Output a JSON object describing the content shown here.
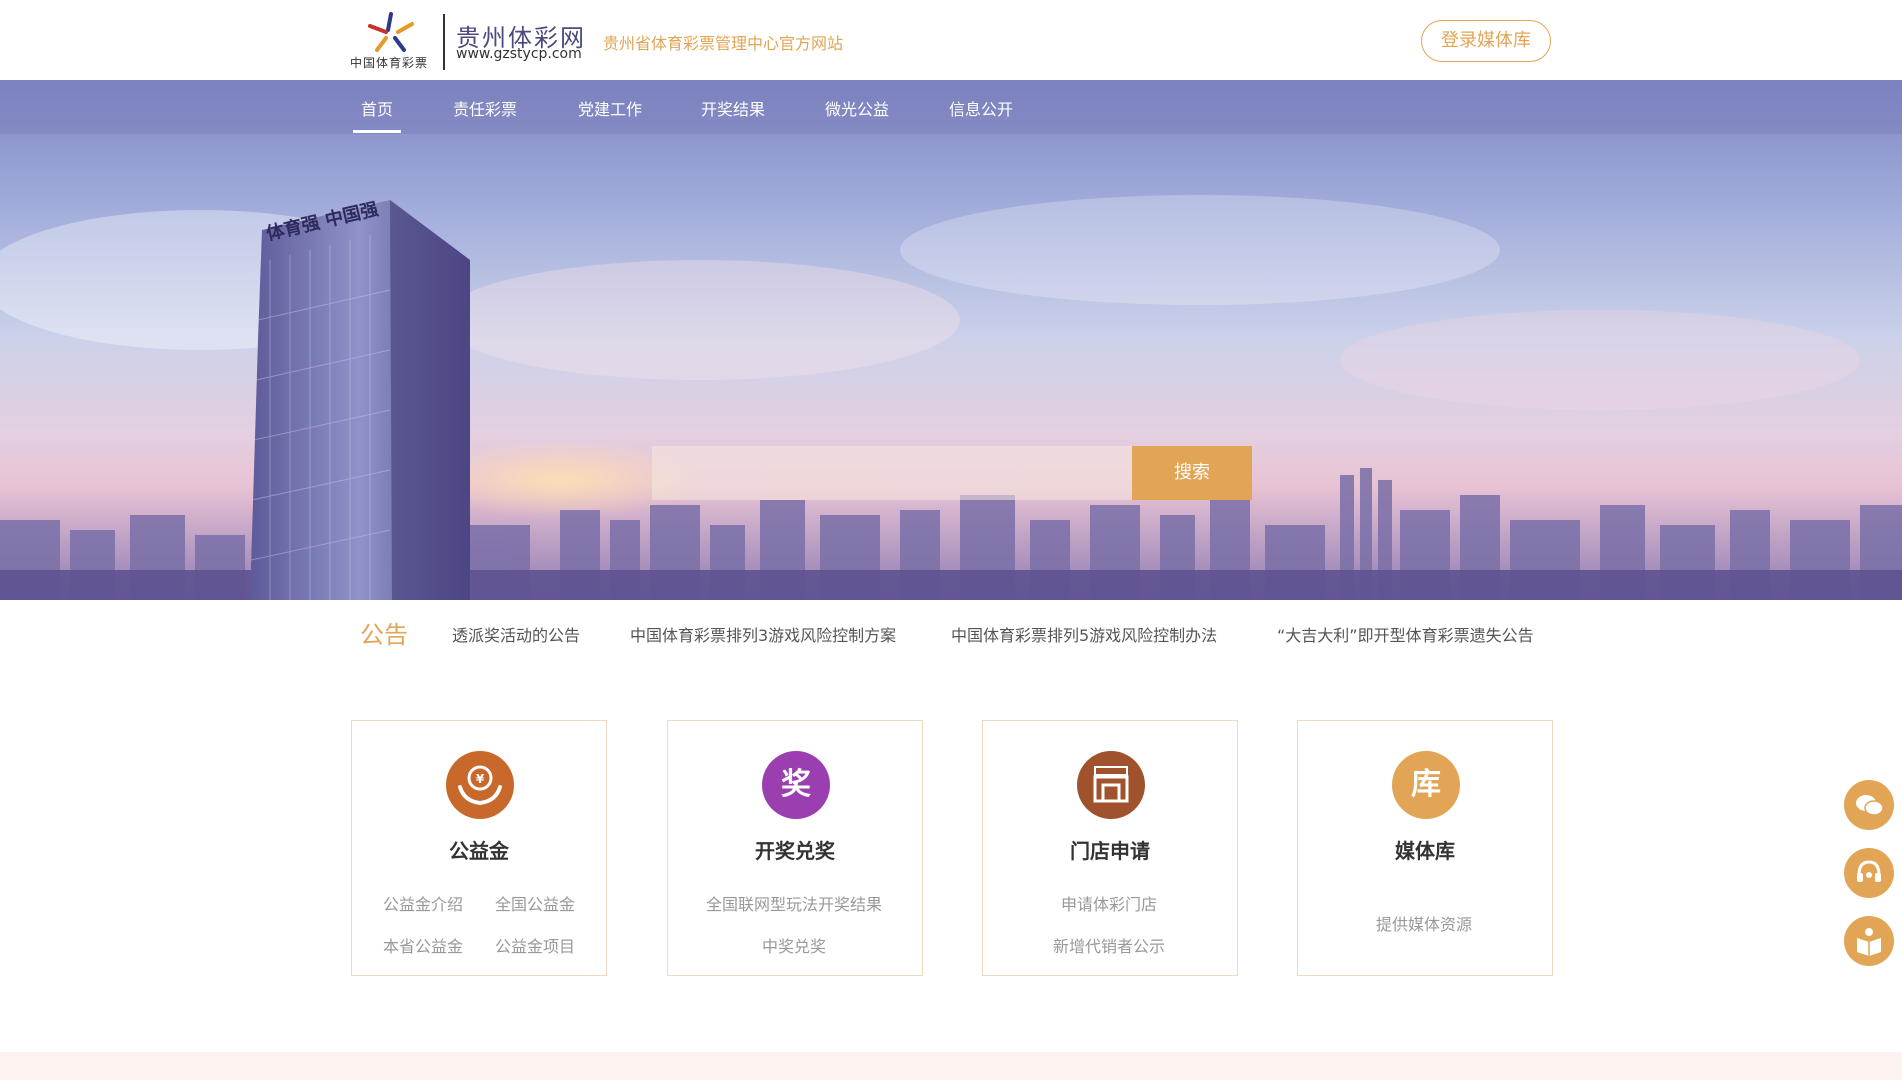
{
  "header": {
    "logo_caption": "中国体育彩票",
    "site_name": "贵州体彩网",
    "site_url": "www.gzstycp.com",
    "slogan": "贵州省体育彩票管理中心官方网站",
    "login_label": "登录媒体库"
  },
  "nav": {
    "items": [
      "首页",
      "责任彩票",
      "党建工作",
      "开奖结果",
      "微光公益",
      "信息公开"
    ],
    "active_index": 0
  },
  "hero": {
    "building_sign": "体育强 中国强",
    "search_value": "",
    "search_button_label": "搜索"
  },
  "notice": {
    "title": "公告",
    "items": [
      "透派奖活动的公告",
      "中国体育彩票排列3游戏风险控制方案",
      "中国体育彩票排列5游戏风险控制办法",
      "“大吉大利”即开型体育彩票遗失公告"
    ]
  },
  "cards": [
    {
      "title": "公益金",
      "icon": "charity-hands-icon",
      "icon_char": "",
      "links": [
        "公益金介绍",
        "全国公益金",
        "本省公益金",
        "公益金项目"
      ]
    },
    {
      "title": "开奖兑奖",
      "icon": "prize-icon",
      "icon_char": "奖",
      "links": [
        "全国联网型玩法开奖结果",
        "中奖兑奖"
      ]
    },
    {
      "title": "门店申请",
      "icon": "store-icon",
      "icon_char": "",
      "links": [
        "申请体彩门店",
        "新增代销者公示"
      ]
    },
    {
      "title": "媒体库",
      "icon": "library-icon",
      "icon_char": "库",
      "links": [
        "提供媒体资源"
      ]
    }
  ],
  "side_buttons": [
    "wechat-icon",
    "customer-service-icon",
    "guide-book-icon"
  ],
  "colors": {
    "accent": "#e2a455",
    "brand_text": "#4a4a7c",
    "charity_icon": "#c8682a",
    "prize_icon": "#9b3fb0",
    "store_icon": "#a0522d",
    "library_icon": "#e2a455"
  }
}
